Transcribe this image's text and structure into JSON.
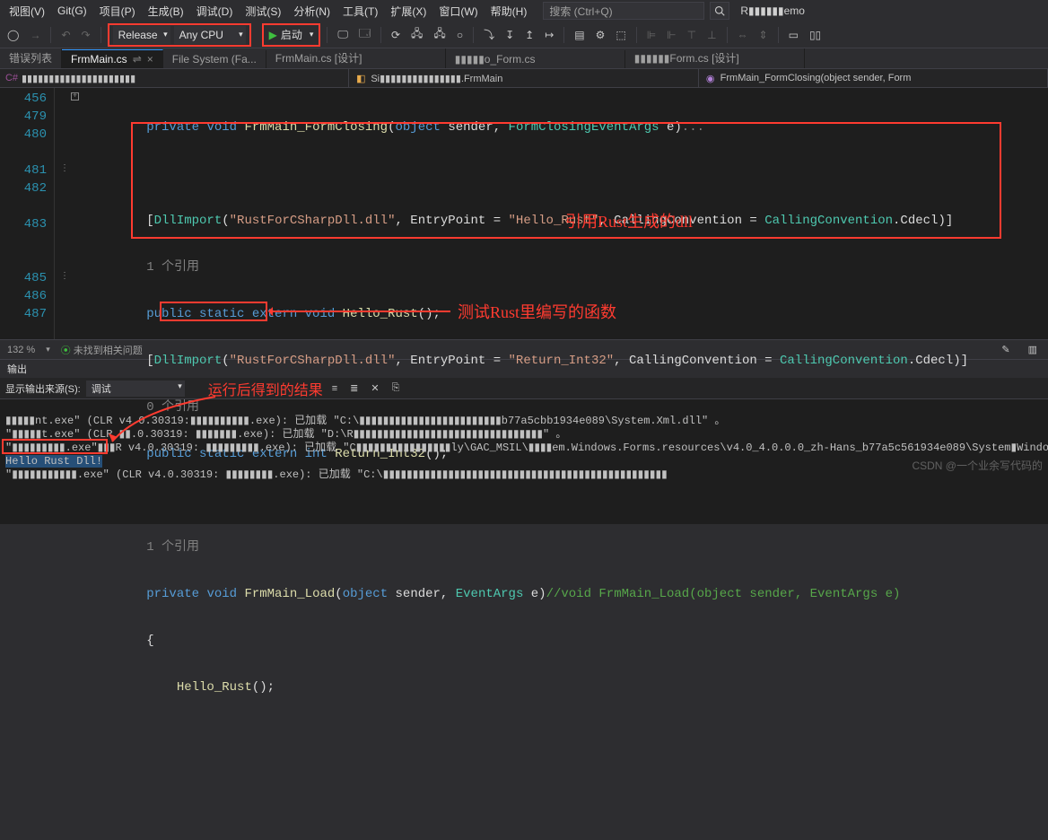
{
  "menu": {
    "items": [
      "视图(V)",
      "Git(G)",
      "项目(P)",
      "生成(B)",
      "调试(D)",
      "测试(S)",
      "分析(N)",
      "工具(T)",
      "扩展(X)",
      "窗口(W)",
      "帮助(H)"
    ],
    "search_placeholder": "搜索 (Ctrl+Q)",
    "project": "R▮▮▮▮▮▮emo"
  },
  "toolbar": {
    "config": "Release",
    "platform": "Any CPU",
    "run_label": "启动"
  },
  "tabs": {
    "err": "错误列表",
    "t0": "FrmMain.cs",
    "t1": "File System (Fa...",
    "t2": "FrmMain.cs [设计]",
    "t3": "▮▮▮▮▮o_Form.cs",
    "t4": "▮▮▮▮▮▮Form.cs [设计]"
  },
  "nav": {
    "proj": "▮▮▮▮▮▮▮▮▮▮▮▮▮▮▮▮▮▮▮▮▮",
    "cls": "Si▮▮▮▮▮▮▮▮▮▮▮▮▮▮▮.FrmMain",
    "mtd": "FrmMain_FormClosing(object sender, Form"
  },
  "gutter": [
    "456",
    "479",
    "480",
    "",
    "481",
    "482",
    "",
    "483",
    "",
    "",
    "485",
    "486",
    "487"
  ],
  "code": {
    "l1a": "private",
    "l1b": "void",
    "l1c": "FrmMain_FormClosing",
    "l1d": "object",
    "l1e": "sender,",
    "l1f": "FormClosingEventArgs",
    "l1g": "e)",
    "l3a": "[",
    "l3b": "DllImport",
    "l3c": "(",
    "l3d": "\"RustForCSharpDll.dll\"",
    "l3e": ", EntryPoint = ",
    "l3f": "\"Hello_Rust\"",
    "l3g": ", CallingConvention = ",
    "l3h": "CallingConvention",
    "l3i": ".Cdecl)]",
    "l4": "1 个引用",
    "l5a": "public static extern void",
    "l5b": "Hello_Rust",
    "l5c": "();",
    "l6a": "[",
    "l6b": "DllImport",
    "l6c": "(",
    "l6d": "\"RustForCSharpDll.dll\"",
    "l6e": ", EntryPoint = ",
    "l6f": "\"Return_Int32\"",
    "l6g": ", CallingConvention = ",
    "l6h": "CallingConvention",
    "l6i": ".Cdecl)]",
    "l7": "0 个引用",
    "l8a": "public static extern int",
    "l8b": "Return_Int32",
    "l8c": "();",
    "l10": "1 个引用",
    "l11a": "private",
    "l11b": "void",
    "l11c": "FrmMain_Load",
    "l11d": "object",
    "l11e": "sender,",
    "l11f": "EventArgs",
    "l11g": "e)",
    "l11h": "//void FrmMain_Load(object sender, EventArgs e)",
    "l12": "{",
    "l13a": "Hello_Rust",
    "l13b": "();"
  },
  "anno": {
    "a1": "引用Rust生成的dll",
    "a2": "测试Rust里编写的函数",
    "a3": "运行后得到的结果"
  },
  "status": {
    "zoom": "132 %",
    "issues": "未找到相关问题"
  },
  "output": {
    "title": "输出",
    "src_label": "显示输出来源(S):",
    "src_value": "调试",
    "lines": [
      "▮▮▮▮▮nt.exe\" (CLR v4.0.30319:▮▮▮▮▮▮▮▮▮▮.exe): 已加载 \"C:\\▮▮▮▮▮▮▮▮▮▮▮▮▮▮▮▮▮▮▮▮▮▮▮▮b77a5cbb1934e089\\System.Xml.dll\" 。",
      "\"▮▮▮▮▮t.exe\" (CLR ▮▮.0.30319: ▮▮▮▮▮▮▮.exe): 已加载 \"D:\\R▮▮▮▮▮▮▮▮▮▮▮▮▮▮▮▮▮▮▮▮▮▮▮▮▮▮▮▮▮▮▮▮\" 。",
      "\"▮▮▮▮▮▮▮▮▮.exe\"▮▮▮R v4.0.30319: ▮▮▮▮▮▮▮▮▮.exe): 已加载 \"C▮▮▮▮▮▮▮▮▮▮▮▮▮▮▮▮ly\\GAC_MSIL\\▮▮▮▮em.Windows.Forms.resources\\v4.0_4.0.0.0_zh-Hans_b77a5c561934e089\\System▮Windows.",
      "Hello Rust Dll!",
      "\"▮▮▮▮▮▮▮▮▮▮▮.exe\" (CLR v4.0.30319: ▮▮▮▮▮▮▮▮.exe): 已加载 \"C:\\▮▮▮▮▮▮▮▮▮▮▮▮▮▮▮▮▮▮▮▮▮▮▮▮▮▮▮▮▮▮▮▮▮▮▮▮▮▮▮▮▮▮▮▮▮▮▮▮"
    ]
  },
  "watermark": "CSDN @一个业余写代码的"
}
